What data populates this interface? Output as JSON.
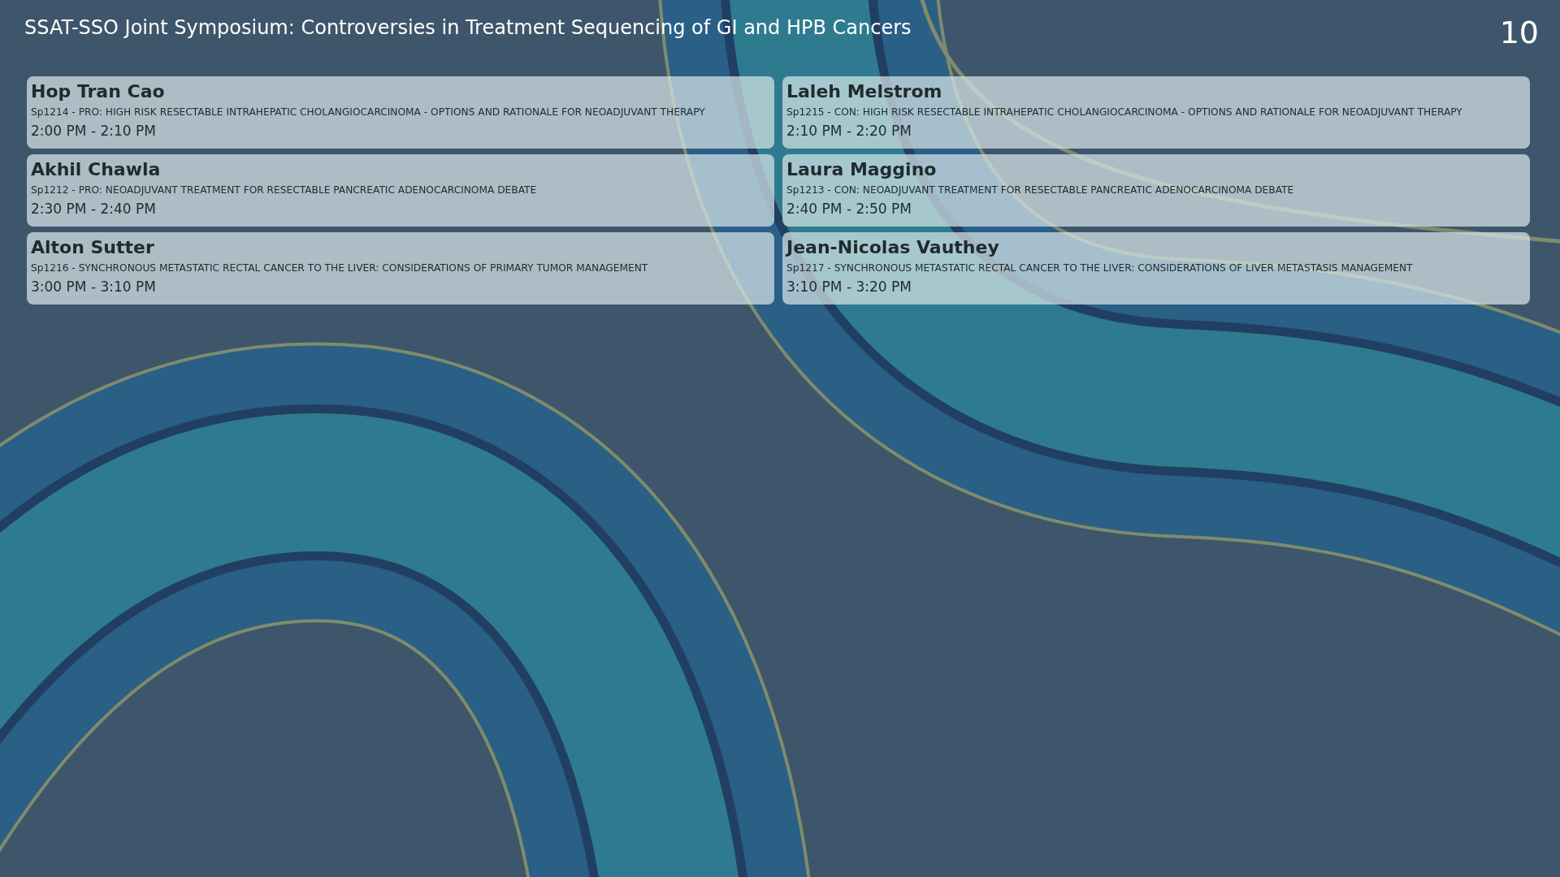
{
  "header": {
    "title": "SSAT-SSO Joint Symposium: Controversies in Treatment Sequencing of GI and HPB Cancers",
    "page_number": "10"
  },
  "sessions": [
    {
      "speaker": "Hop Tran Cao",
      "topic": "Sp1214 - PRO: HIGH RISK RESECTABLE INTRAHEPATIC CHOLANGIOCARCINOMA - OPTIONS AND RATIONALE FOR NEOADJUVANT THERAPY",
      "time": "2:00 PM - 2:10 PM"
    },
    {
      "speaker": "Laleh Melstrom",
      "topic": "Sp1215 - CON: HIGH RISK RESECTABLE INTRAHEPATIC CHOLANGIOCARCINOMA - OPTIONS AND RATIONALE FOR NEOADJUVANT THERAPY",
      "time": "2:10 PM - 2:20 PM"
    },
    {
      "speaker": "Akhil Chawla",
      "topic": "Sp1212 - PRO: NEOADJUVANT TREATMENT FOR RESECTABLE PANCREATIC ADENOCARCINOMA DEBATE",
      "time": "2:30 PM - 2:40 PM"
    },
    {
      "speaker": "Laura Maggino",
      "topic": "Sp1213 - CON: NEOADJUVANT TREATMENT FOR RESECTABLE PANCREATIC ADENOCARCINOMA DEBATE",
      "time": "2:40 PM - 2:50 PM"
    },
    {
      "speaker": "Alton Sutter",
      "topic": "Sp1216 - SYNCHRONOUS METASTATIC RECTAL CANCER TO THE LIVER: CONSIDERATIONS OF PRIMARY TUMOR MANAGEMENT",
      "time": "3:00 PM - 3:10 PM"
    },
    {
      "speaker": "Jean-Nicolas Vauthey",
      "topic": "Sp1217 - SYNCHRONOUS METASTATIC RECTAL CANCER TO THE LIVER: CONSIDERATIONS OF LIVER METASTASIS MANAGEMENT",
      "time": "3:10 PM - 3:20 PM"
    }
  ]
}
